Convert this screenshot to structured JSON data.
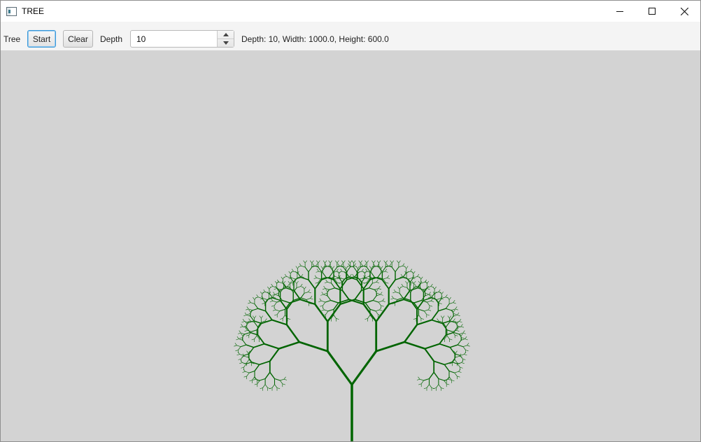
{
  "window": {
    "title": "TREE",
    "controls": [
      "minimize",
      "maximize",
      "close"
    ]
  },
  "toolbar": {
    "tree_label": "Tree",
    "start_label": "Start",
    "clear_label": "Clear",
    "depth_label": "Depth",
    "depth_value": "10",
    "status_text": "Depth: 10,  Width: 1000.0, Height: 600.0"
  },
  "canvas": {
    "background": "#d3d3d3",
    "tree_color": "#006400",
    "depth": 10
  }
}
